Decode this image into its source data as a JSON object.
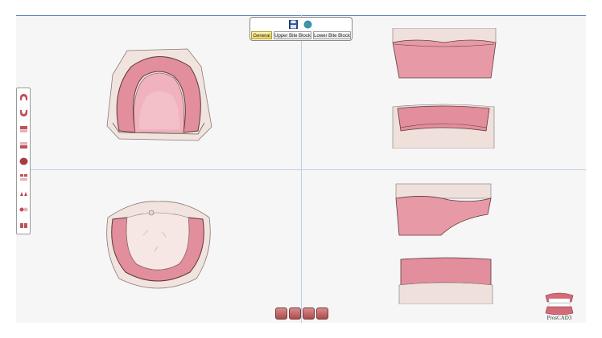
{
  "toolbar": {
    "top_left_icons": [
      "pencil-icon",
      "open-folder-icon",
      "edit-folder-icon"
    ],
    "center_icons": [
      "save-icon",
      "globe-icon"
    ],
    "tabs": [
      {
        "label": "General",
        "active": true
      },
      {
        "label": "Upper Bite Block",
        "active": false
      },
      {
        "label": "Lower Bite Block",
        "active": false
      }
    ]
  },
  "left_toolbar": {
    "icons": [
      "upper-arch-icon",
      "lower-arch-icon",
      "front-view-icon",
      "back-view-icon",
      "full-denture-icon",
      "jaw-view-icon",
      "left-view-icon",
      "right-view-icon",
      "split-view-icon"
    ]
  },
  "bottom_toolbar": {
    "icons": [
      "upper-arch-view-icon",
      "lower-arch-view-icon",
      "bite-view-icon",
      "denture-view-icon"
    ]
  },
  "logo": {
    "text": "ProsCAD3"
  },
  "colors": {
    "gum": "#e89aa6",
    "base": "#f3e2dd",
    "accent": "#f2d25a",
    "viewport_line": "#b9cee6"
  }
}
